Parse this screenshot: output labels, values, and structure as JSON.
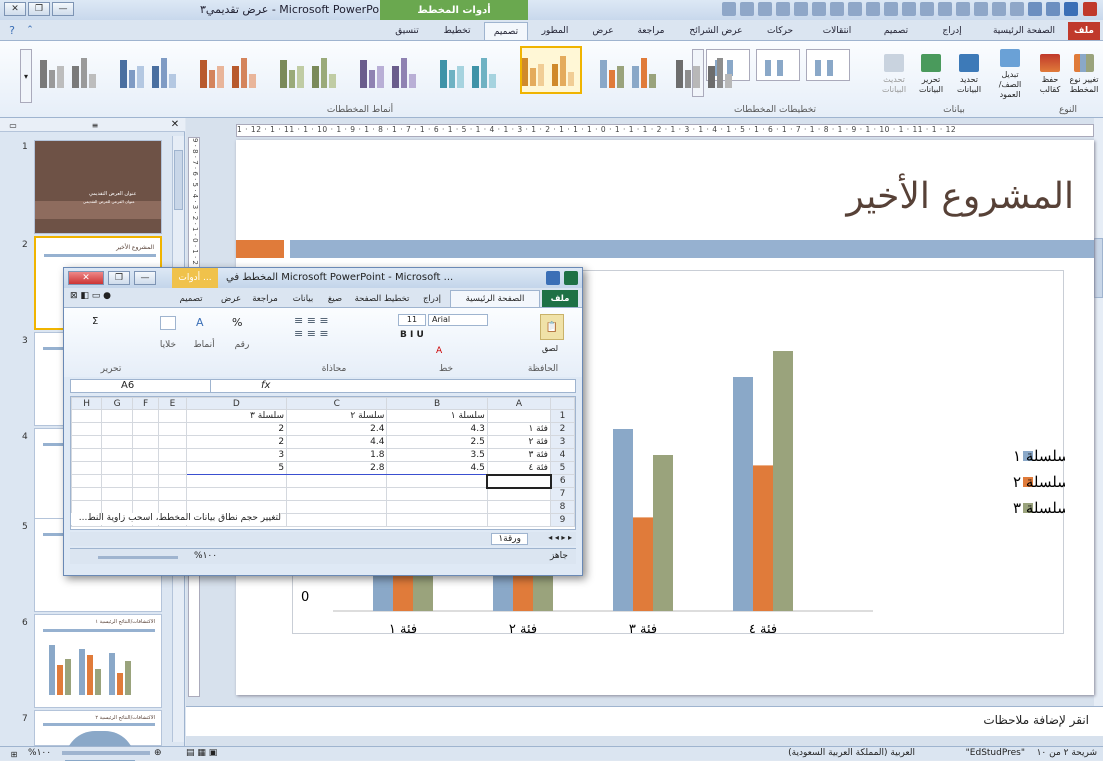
{
  "window": {
    "title": "عرض تقديمي٣ - Microsoft PowerPoint",
    "context_tab": "أدوات المخطط"
  },
  "tabs": [
    "ملف",
    "الصفحة الرئيسية",
    "إدراج",
    "تصميم",
    "انتقالات",
    "حركات",
    "عرض الشرائح",
    "مراجعة",
    "عرض",
    "المطور",
    "تصميم",
    "تخطيط",
    "تنسيق"
  ],
  "ribbon": {
    "type_group": "النوع",
    "type_buttons": [
      "تغيير نوع المخطط",
      "حفظ كقالب"
    ],
    "data_group": "بيانات",
    "data_buttons": [
      "تبديل الصف/العمود",
      "تحديد البيانات",
      "تحرير البيانات",
      "تحديث البيانات"
    ],
    "layouts_group": "تخطيطات المخططات",
    "styles_group": "أنماط المخططات"
  },
  "thumbnails": [
    {
      "num": "1",
      "lines": [
        "عنوان العرض التقديمي",
        "عنوان الفرعي للعرض التقديمي"
      ]
    },
    {
      "num": "2",
      "title": "المشروع الأخير"
    },
    {
      "num": "3"
    },
    {
      "num": "4"
    },
    {
      "num": "5"
    },
    {
      "num": "6",
      "title": "الاكتشافات/النتائج الرئيسية ١"
    },
    {
      "num": "7",
      "title": "الاكتشافات/النتائج الرئيسية ٢"
    }
  ],
  "ruler": "1 · 12 · 1 · 11 · 1 · 10 · 1 · 9 · 1 · 8 · 1 · 7 · 1 · 6 · 1 · 5 · 1 · 4 · 1 · 3 · 1 · 2 · 1 · 1 · 1 · 0 · 1 · 1 · 1 · 2 · 1 · 3 · 1 · 4 · 1 · 5 · 1 · 6 · 1 · 7 · 1 · 8 · 1 · 9 · 1 · 10 · 1 · 11 · 1 · 12",
  "vruler": "9 · 8 · 7 · 6 · 5 · 4 · 3 · 2 · 1 · 0 · 1 · 2 · 3 · 4 · 5 · 6 · 7 · 8 · 9",
  "slide": {
    "title": "المشروع الأخير"
  },
  "chart_data": {
    "type": "bar",
    "categories": [
      "فئة ١",
      "فئة ٢",
      "فئة ٣",
      "فئة ٤"
    ],
    "series": [
      {
        "name": "سلسلة ١",
        "values": [
          4.3,
          2.5,
          3.5,
          4.5
        ],
        "color": "#8aa8c8"
      },
      {
        "name": "سلسلة ٢",
        "values": [
          2.4,
          4.4,
          1.8,
          2.8
        ],
        "color": "#e07b3a"
      },
      {
        "name": "سلسلة ٣",
        "values": [
          2,
          2,
          3,
          5
        ],
        "color": "#9aa37c"
      }
    ],
    "ylim": [
      0,
      6
    ],
    "visible_tick": "0",
    "legend": "right"
  },
  "notes": "انقر لإضافة ملاحظات",
  "status": {
    "slide": "شريحة ٢ من ١٠",
    "theme": "\"EdStudPres\"",
    "lang": "العربية (المملكة العربية السعودية)",
    "zoom": "%١٠٠"
  },
  "excel": {
    "title": "المخطط في Microsoft PowerPoint - Microsoft ...",
    "context": "أدوات ...",
    "tabs": [
      "ملف",
      "الصفحة الرئيسية",
      "إدراج",
      "تخطيط الصفحة",
      "صيغ",
      "بيانات",
      "مراجعة",
      "عرض",
      "تصميم"
    ],
    "groups": [
      "الحافظة",
      "خط",
      "محاذاة",
      "رقم",
      "أنماط",
      "خلايا",
      "تحرير"
    ],
    "font": "Arial",
    "font_size": "11",
    "paste": "لصق",
    "namebox": "A6",
    "fx": "fx",
    "columns": [
      "A",
      "B",
      "C",
      "D",
      "E",
      "F",
      "G",
      "H"
    ],
    "rows": [
      {
        "n": "1",
        "A": "",
        "B": "سلسلة ١",
        "C": "سلسلة ٢",
        "D": "سلسلة ٣"
      },
      {
        "n": "2",
        "A": "فئة ١",
        "B": "4.3",
        "C": "2.4",
        "D": "2"
      },
      {
        "n": "3",
        "A": "فئة ٢",
        "B": "2.5",
        "C": "4.4",
        "D": "2"
      },
      {
        "n": "4",
        "A": "فئة ٣",
        "B": "3.5",
        "C": "1.8",
        "D": "3"
      },
      {
        "n": "5",
        "A": "فئة ٤",
        "B": "4.5",
        "C": "2.8",
        "D": "5"
      },
      {
        "n": "6",
        "A": "",
        "B": "",
        "C": "",
        "D": ""
      },
      {
        "n": "7",
        "A": "",
        "B": "",
        "C": "",
        "D": ""
      },
      {
        "n": "8",
        "A": "",
        "B": "",
        "C": "",
        "D": ""
      },
      {
        "n": "9",
        "A": "",
        "B": "",
        "C": "",
        "D": ""
      }
    ],
    "note": "لتغيير حجم نطاق بيانات المخطط، اسحب زاوية النط...",
    "sheet": "ورقة١",
    "status": "جاهز",
    "zoom": "%١٠٠"
  }
}
